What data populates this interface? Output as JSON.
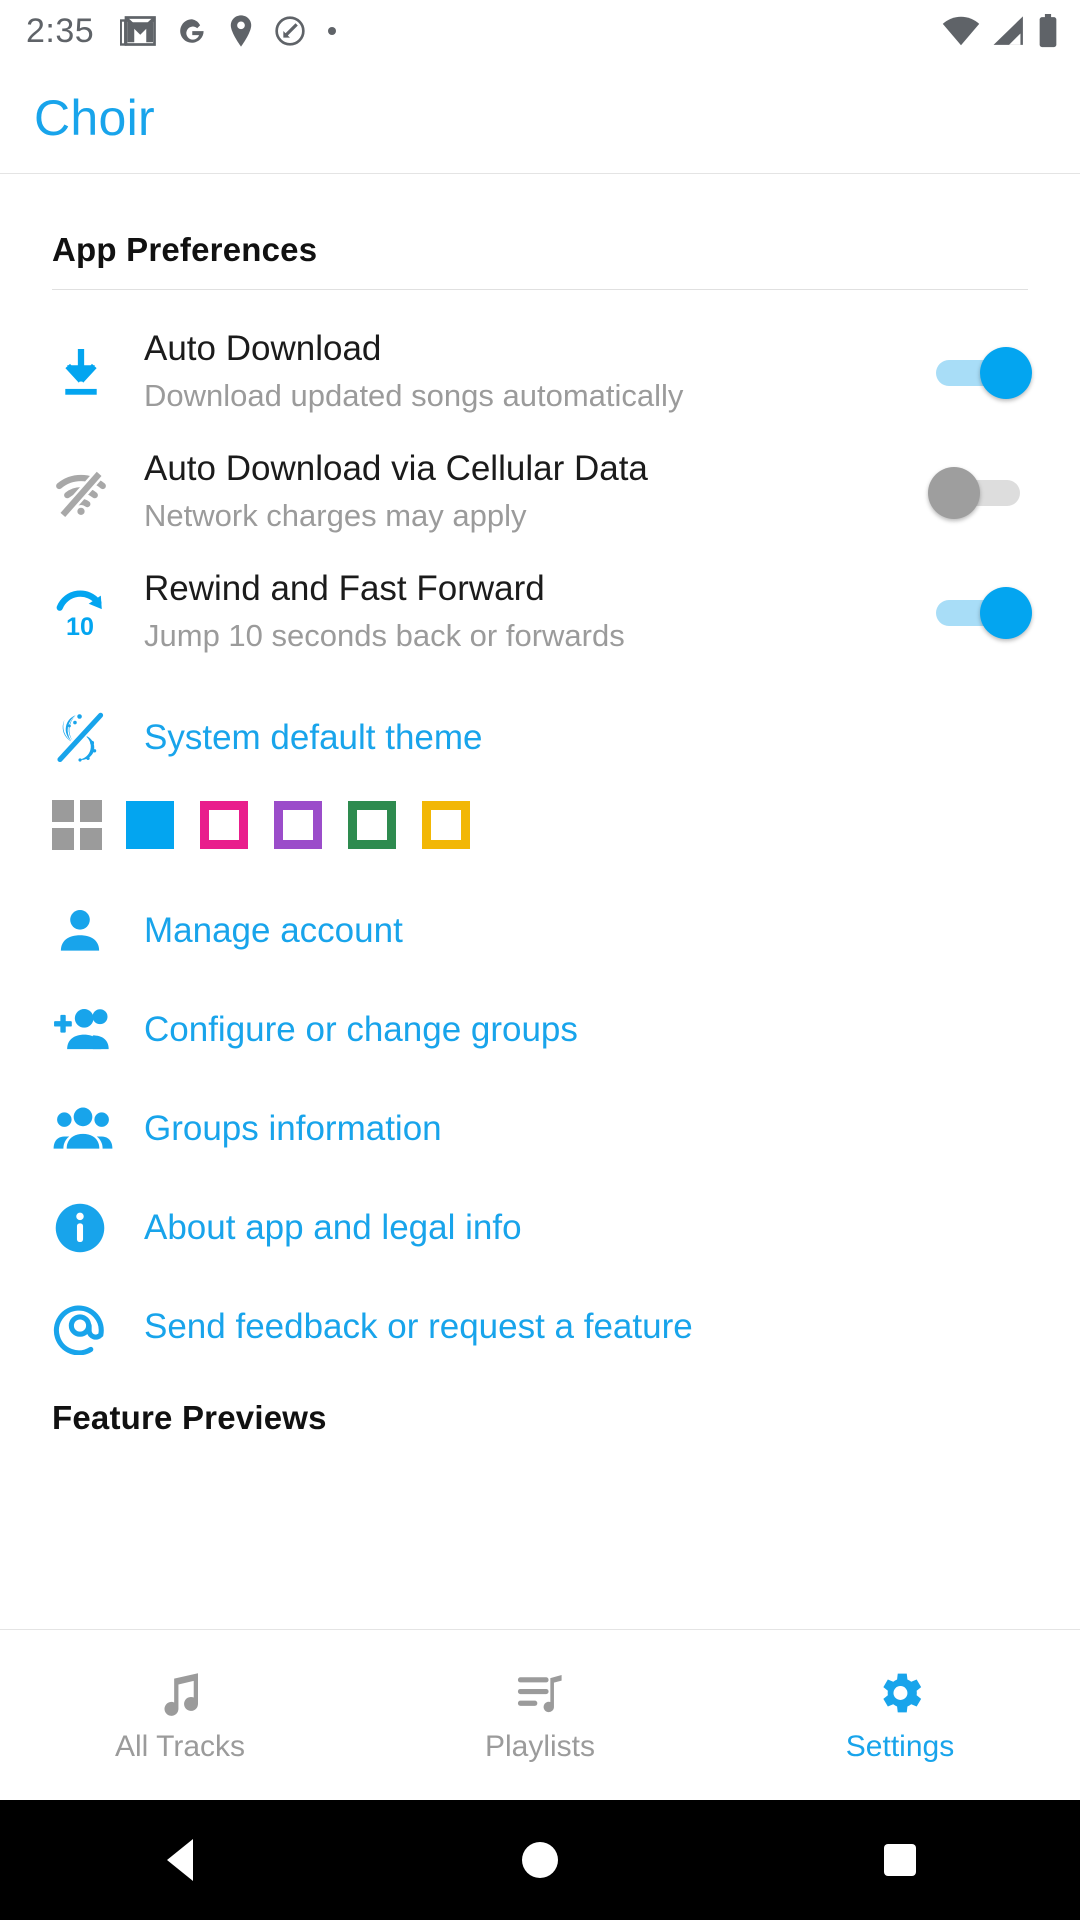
{
  "status_bar": {
    "time": "2:35",
    "left_icons": [
      "gmail-icon",
      "google-icon",
      "location-pin-icon",
      "circle-slash-icon",
      "dot-icon"
    ],
    "right_icons": [
      "wifi-icon",
      "cellular-signal-icon",
      "battery-icon"
    ]
  },
  "app_bar": {
    "title": "Choir"
  },
  "colors": {
    "accent": "#18a4eb",
    "accent_bright": "#03a5f0",
    "title_text": "#1b1b1b",
    "subtitle_text": "#9b9b9b",
    "section_text": "#111111",
    "off_thumb": "#9e9e9e"
  },
  "sections": [
    {
      "title": "App Preferences"
    },
    {
      "title": "Feature Previews"
    }
  ],
  "preferences": [
    {
      "icon": "download-icon",
      "title": "Auto Download",
      "subtitle": "Download updated songs automatically",
      "toggle": "on"
    },
    {
      "icon": "wifi-off-icon",
      "title": "Auto Download via Cellular Data",
      "subtitle": "Network charges may apply",
      "toggle": "off"
    },
    {
      "icon": "replay-10-icon",
      "title": "Rewind and Fast Forward",
      "subtitle": "Jump 10 seconds back or forwards",
      "toggle": "on"
    }
  ],
  "theme": {
    "icon": "theme-moon-sun-icon",
    "label": "System default theme",
    "swatches": [
      {
        "name": "grid-default",
        "style": "grid",
        "color": "#9b9b9b"
      },
      {
        "name": "blue",
        "style": "filled",
        "color": "#03a5f0",
        "selected": true
      },
      {
        "name": "pink",
        "style": "outline",
        "color": "#e91e8c",
        "selected": false
      },
      {
        "name": "purple",
        "style": "outline",
        "color": "#9b4dca",
        "selected": false
      },
      {
        "name": "green",
        "style": "outline",
        "color": "#2e8b4f",
        "selected": false
      },
      {
        "name": "amber",
        "style": "outline",
        "color": "#f2b705",
        "selected": false
      }
    ]
  },
  "links": [
    {
      "icon": "person-icon",
      "label": "Manage account"
    },
    {
      "icon": "person-add-group-icon",
      "label": "Configure or change groups"
    },
    {
      "icon": "people-group-icon",
      "label": "Groups information"
    },
    {
      "icon": "info-circle-icon",
      "label": "About app and legal info"
    },
    {
      "icon": "at-sign-icon",
      "label": "Send feedback or request a feature"
    }
  ],
  "bottom_nav": [
    {
      "icon": "music-note-icon",
      "label": "All Tracks",
      "active": false
    },
    {
      "icon": "playlist-icon",
      "label": "Playlists",
      "active": false
    },
    {
      "icon": "gear-icon",
      "label": "Settings",
      "active": true
    }
  ],
  "android_nav": {
    "back": "back-triangle-icon",
    "home": "home-circle-icon",
    "recents": "recents-square-icon"
  }
}
